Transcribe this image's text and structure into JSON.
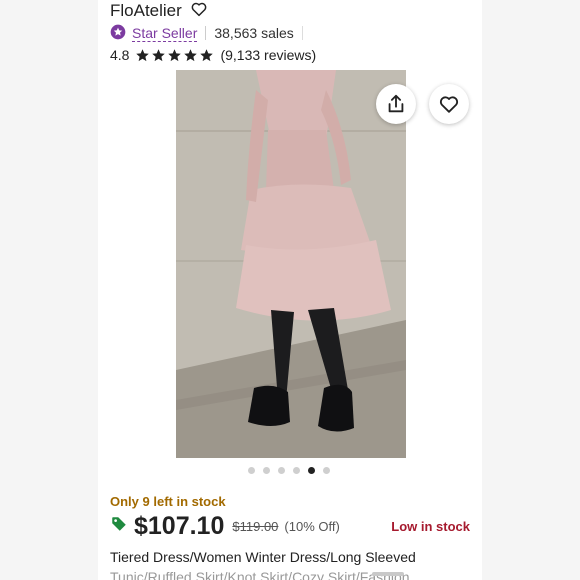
{
  "shop": {
    "name": "FloAtelier",
    "badge": "Star Seller",
    "sales": "38,563 sales"
  },
  "rating": {
    "score": "4.8",
    "reviews": "(9,133 reviews)",
    "stars": 5
  },
  "gallery": {
    "total": 6,
    "active": 4
  },
  "stock_notice": "Only 9 left in stock",
  "price": {
    "current": "$107.10",
    "original": "$119.00",
    "discount": "(10% Off)",
    "status": "Low in stock"
  },
  "listing": {
    "title": "Tiered Dress/Women Winter Dress/Long Sleeved",
    "title_clipped": "Tunic/Ruffled Skirt/Knot Skirt/Cozy Skirt/Fashion"
  },
  "colors": {
    "brand_purple": "#7c3ba0",
    "stock_gold": "#a26a00",
    "low_stock_red": "#a61a2e",
    "tag_green": "#1f8a3f"
  }
}
